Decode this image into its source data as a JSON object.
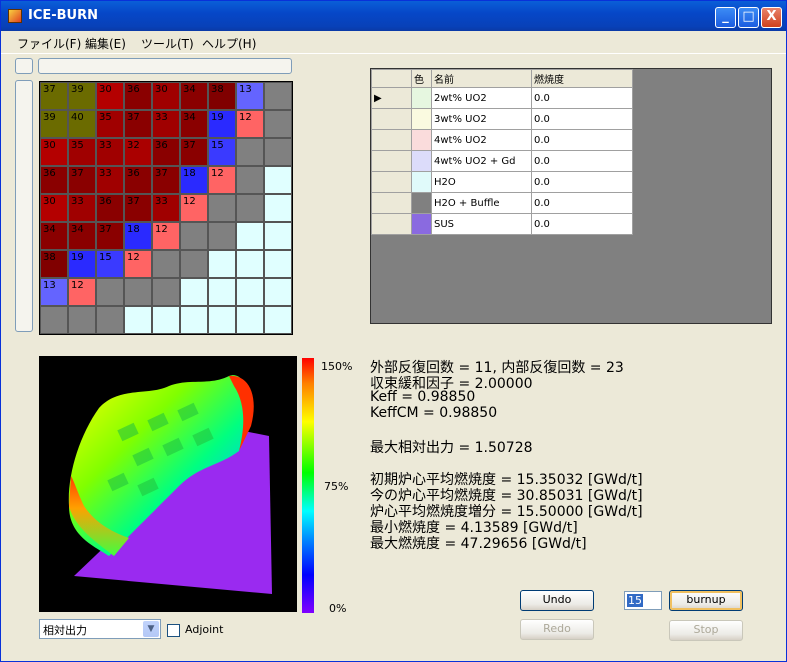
{
  "window": {
    "title": "ICE-BURN",
    "min_glyph": "_",
    "max_glyph": "□",
    "close_glyph": "X"
  },
  "menu": [
    "ファイル(F)",
    "編集(E)",
    "ツール(T)",
    "ヘルプ(H)"
  ],
  "grid": {
    "rows": [
      [
        "37",
        "39",
        "30",
        "36",
        "30",
        "34",
        "38",
        "13",
        ""
      ],
      [
        "39",
        "40",
        "35",
        "37",
        "33",
        "34",
        "19",
        "12",
        ""
      ],
      [
        "30",
        "35",
        "33",
        "32",
        "36",
        "37",
        "15",
        "",
        ""
      ],
      [
        "36",
        "37",
        "33",
        "36",
        "37",
        "18",
        "12",
        "",
        ""
      ],
      [
        "30",
        "33",
        "36",
        "37",
        "33",
        "12",
        "",
        "",
        ""
      ],
      [
        "34",
        "34",
        "37",
        "18",
        "12",
        "",
        "",
        "",
        ""
      ],
      [
        "38",
        "19",
        "15",
        "12",
        "",
        "",
        "",
        "",
        ""
      ],
      [
        "13",
        "12",
        "",
        "",
        "",
        "",
        "",
        "",
        ""
      ],
      [
        "",
        "",
        "",
        "",
        "",
        "",
        "",
        "",
        ""
      ]
    ],
    "colors": [
      [
        "#6b6b00",
        "#6b6b00",
        "#b40000",
        "#8a0000",
        "#a00000",
        "#8a0000",
        "#800000",
        "#6464ff",
        "#808080"
      ],
      [
        "#6b6b00",
        "#6b6b00",
        "#a00000",
        "#8a0000",
        "#a00000",
        "#8a0000",
        "#2a2aff",
        "#ff6464",
        "#808080"
      ],
      [
        "#b40000",
        "#a00000",
        "#a00000",
        "#aa0000",
        "#8a0000",
        "#8a0000",
        "#3a3aff",
        "#808080",
        "#808080"
      ],
      [
        "#8a0000",
        "#8a0000",
        "#a00000",
        "#8a0000",
        "#8a0000",
        "#2a2aff",
        "#ff6464",
        "#808080",
        "#e0ffff"
      ],
      [
        "#b40000",
        "#a00000",
        "#8a0000",
        "#8a0000",
        "#a00000",
        "#ff6464",
        "#808080",
        "#808080",
        "#e0ffff"
      ],
      [
        "#8a0000",
        "#8a0000",
        "#8a0000",
        "#2a2aff",
        "#ff6464",
        "#808080",
        "#808080",
        "#e0ffff",
        "#e0ffff"
      ],
      [
        "#800000",
        "#2a2aff",
        "#3a3aff",
        "#ff6464",
        "#808080",
        "#808080",
        "#e0ffff",
        "#e0ffff",
        "#e0ffff"
      ],
      [
        "#6464ff",
        "#ff6464",
        "#808080",
        "#808080",
        "#808080",
        "#e0ffff",
        "#e0ffff",
        "#e0ffff",
        "#e0ffff"
      ],
      [
        "#808080",
        "#808080",
        "#808080",
        "#e0ffff",
        "#e0ffff",
        "#e0ffff",
        "#e0ffff",
        "#e0ffff",
        "#e0ffff"
      ]
    ]
  },
  "materials": {
    "headers": {
      "color": "色",
      "name": "名前",
      "burnup": "燃焼度"
    },
    "rows": [
      {
        "name": "2wt% UO2",
        "burnup": "0.0",
        "color": "#e6f7e0"
      },
      {
        "name": "3wt% UO2",
        "burnup": "0.0",
        "color": "#fafae0"
      },
      {
        "name": "4wt% UO2",
        "burnup": "0.0",
        "color": "#fadcdc"
      },
      {
        "name": "4wt% UO2 + Gd",
        "burnup": "0.0",
        "color": "#dcdcfa"
      },
      {
        "name": "H2O",
        "burnup": "0.0",
        "color": "#e0fafa"
      },
      {
        "name": "H2O + Buffle",
        "burnup": "0.0",
        "color": "#808080"
      },
      {
        "name": "SUS",
        "burnup": "0.0",
        "color": "#8a6ae0"
      }
    ],
    "current_marker": "▶"
  },
  "colorbar": {
    "top": "150%",
    "mid": "75%",
    "bottom": "0%"
  },
  "info": {
    "iter": "外部反復回数 = 11,  内部反復回数 = 23",
    "relax": "収束緩和因子 = 2.00000",
    "keff": "Keff = 0.98850",
    "keffcm": "KeffCM = 0.98850",
    "maxpower": "最大相対出力 = 1.50728",
    "init_burn": "初期炉心平均燃焼度 = 15.35032 [GWd/t]",
    "now_burn": "今の炉心平均燃焼度 = 30.85031 [GWd/t]",
    "inc_burn": "炉心平均燃焼度増分 = 15.50000 [GWd/t]",
    "min_burn": "最小燃焼度 = 4.13589 [GWd/t]",
    "max_burn": "最大燃焼度 = 47.29656 [GWd/t]"
  },
  "controls": {
    "undo": "Undo",
    "redo": "Redo",
    "burnup": "burnup",
    "stop": "Stop",
    "step_value": "15",
    "display_select": "相対出力",
    "adjoint": "Adjoint",
    "select_arrow": "▼"
  }
}
